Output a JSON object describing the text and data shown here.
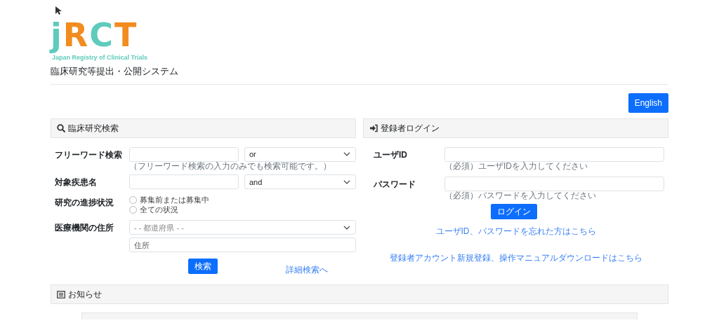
{
  "logo": {
    "letters": [
      {
        "char": "j",
        "color": "#5ecbbd"
      },
      {
        "char": "R",
        "color": "#f28c1e"
      },
      {
        "char": "C",
        "color": "#5ecbbd"
      },
      {
        "char": "T",
        "color": "#f28c1e"
      }
    ],
    "tagline": "Japan Registry of Clinical Trials"
  },
  "system_title": "臨床研究等提出・公開システム",
  "language_button": "English",
  "search": {
    "title": "臨床研究検索",
    "fields": [
      {
        "kind": "text-select",
        "label": "フリーワード検索",
        "hint": "（フリーワード検索の入力のみでも検索可能です。）",
        "operator": "or"
      },
      {
        "kind": "text-select",
        "label": "対象疾患名",
        "operator": "and"
      },
      {
        "kind": "radio",
        "label": "研究の進捗状況",
        "options": [
          {
            "label": "募集前または募集中",
            "selected": false
          },
          {
            "label": "全ての状況",
            "selected": false
          }
        ]
      },
      {
        "kind": "address",
        "label": "医療機関の住所",
        "prefecture": "- - 都道府県 - -",
        "placeholder": "住所"
      }
    ],
    "submit": "検索",
    "advanced_link": "詳細検索へ"
  },
  "login": {
    "title": "登録者ログイン",
    "fields": [
      {
        "label": "ユーザID",
        "hint": "（必須）ユーザIDを入力してください"
      },
      {
        "label": "パスワード",
        "hint": "（必須）パスワードを入力してください"
      }
    ],
    "submit": "ログイン",
    "forgot_link": "ユーザID、パスワードを忘れた方はこちら",
    "register_link": "登録者アカウント新規登録、操作マニュアルダウンロードはこちら"
  },
  "notices": {
    "title": "お知らせ"
  }
}
